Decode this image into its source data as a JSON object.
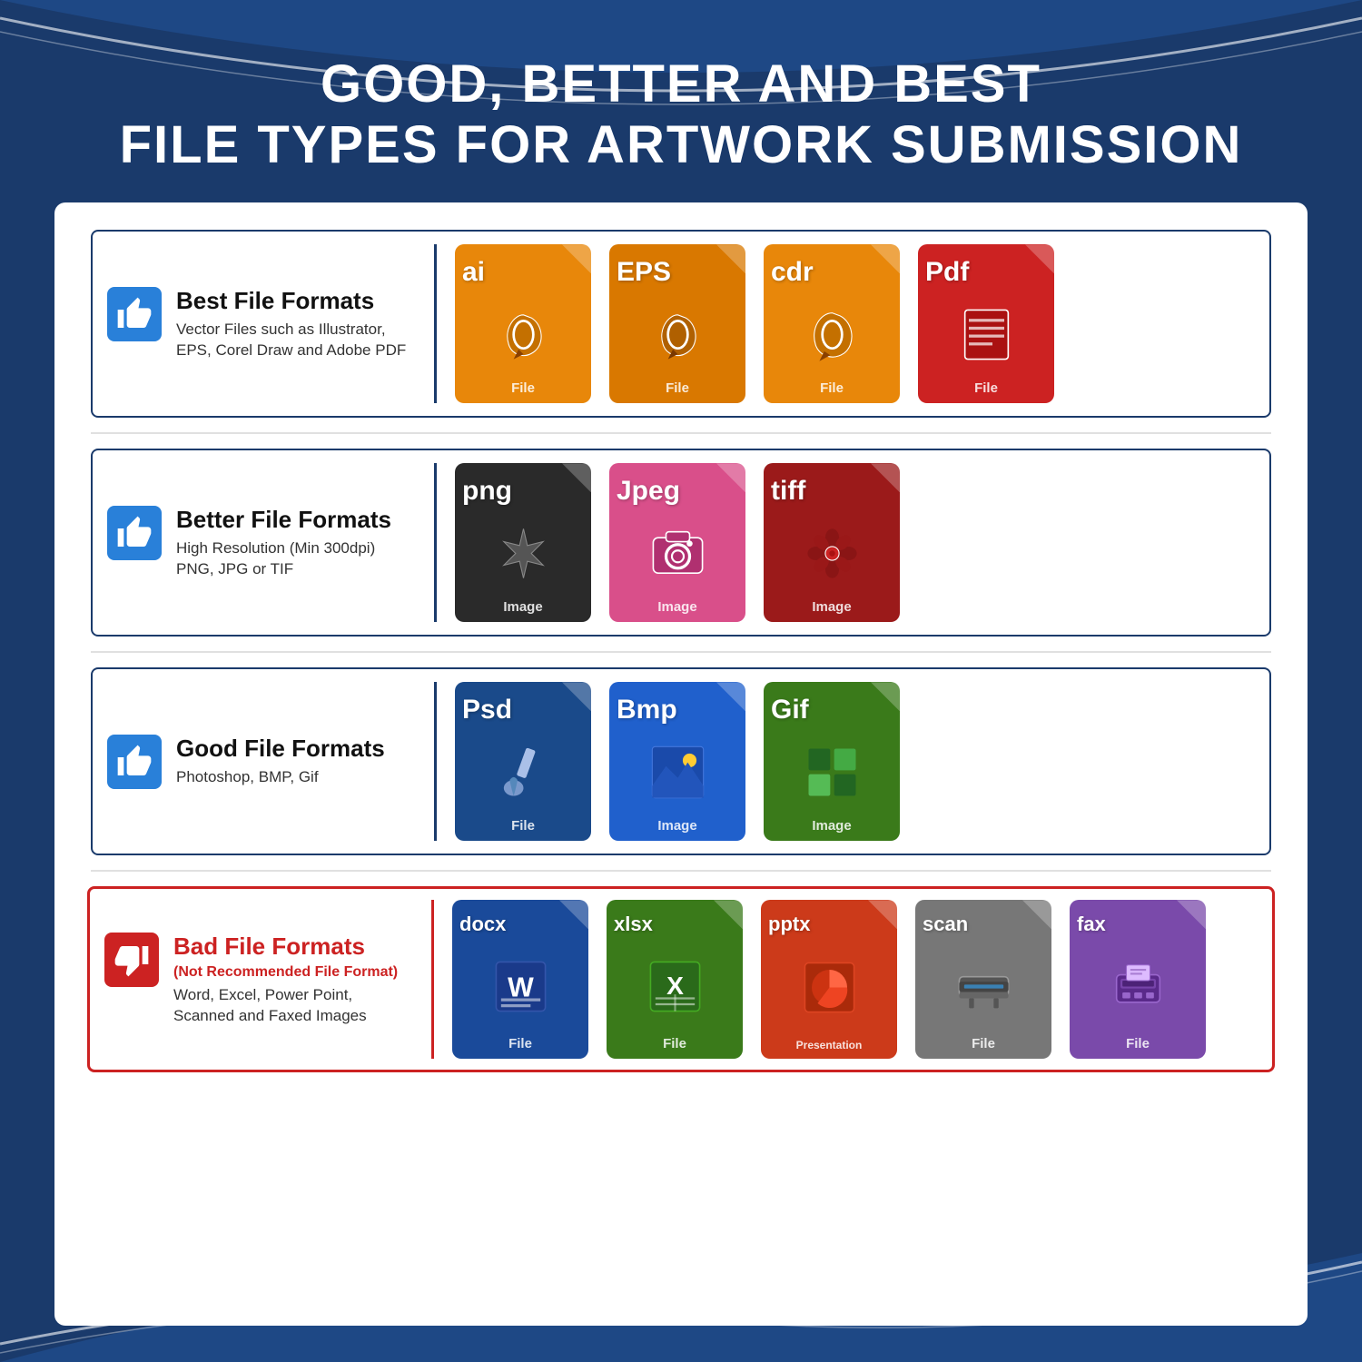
{
  "title": {
    "line1": "GOOD, BETTER AND BEST",
    "line2": "FILE TYPES FOR ARTWORK SUBMISSION"
  },
  "rows": [
    {
      "id": "best",
      "thumbType": "up",
      "label": "Best File Formats",
      "badSub": null,
      "description": "Vector Files such as Illustrator,\nEPS, Corel Draw and Adobe PDF",
      "borderColor": "blue",
      "files": [
        {
          "ext": "ai",
          "color": "orange",
          "iconType": "pen",
          "label": "File"
        },
        {
          "ext": "EPS",
          "color": "orange",
          "iconType": "pen",
          "label": "File"
        },
        {
          "ext": "cdr",
          "color": "orange",
          "iconType": "pen",
          "label": "File"
        },
        {
          "ext": "Pdf",
          "color": "red",
          "iconType": "pdf",
          "label": "File"
        }
      ]
    },
    {
      "id": "better",
      "thumbType": "up",
      "label": "Better File Formats",
      "badSub": null,
      "description": "High Resolution (Min 300dpi)\nPNG, JPG or TIF",
      "borderColor": "blue",
      "files": [
        {
          "ext": "png",
          "color": "black",
          "iconType": "star",
          "label": "Image"
        },
        {
          "ext": "Jpeg",
          "color": "pink",
          "iconType": "camera",
          "label": "Image"
        },
        {
          "ext": "tiff",
          "color": "darkred",
          "iconType": "flower",
          "label": "Image"
        }
      ]
    },
    {
      "id": "good",
      "thumbType": "up",
      "label": "Good File Formats",
      "badSub": null,
      "description": "Photoshop, BMP, Gif",
      "borderColor": "blue",
      "files": [
        {
          "ext": "Psd",
          "color": "navy",
          "iconType": "brush",
          "label": "File"
        },
        {
          "ext": "Bmp",
          "color": "blue",
          "iconType": "mountain",
          "label": "Image"
        },
        {
          "ext": "Gif",
          "color": "green",
          "iconType": "grid",
          "label": "Image"
        }
      ]
    },
    {
      "id": "bad",
      "thumbType": "down",
      "label": "Bad File Formats",
      "badSub": "(Not Recommended File Format)",
      "description": "Word, Excel, Power Point,\nScanned and Faxed Images",
      "borderColor": "red",
      "files": [
        {
          "ext": "docx",
          "color": "blueword",
          "iconType": "word",
          "label": "File"
        },
        {
          "ext": "xlsx",
          "color": "greenexcel",
          "iconType": "excel",
          "label": "File"
        },
        {
          "ext": "pptx",
          "color": "redppt",
          "iconType": "ppt",
          "label": "Presentation"
        },
        {
          "ext": "scan",
          "color": "gray",
          "iconType": "scan",
          "label": "File"
        },
        {
          "ext": "fax",
          "color": "purple",
          "iconType": "fax",
          "label": "File"
        }
      ]
    }
  ]
}
